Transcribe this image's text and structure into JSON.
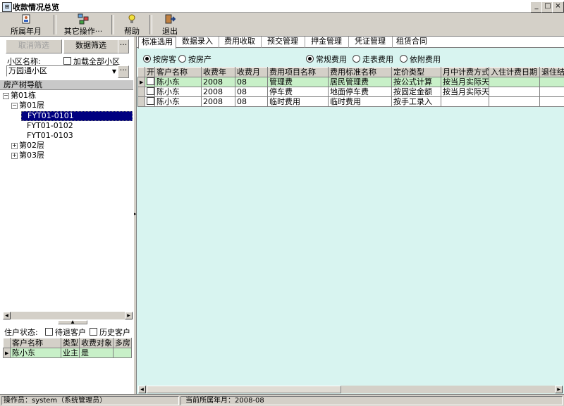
{
  "window": {
    "title": "收款情况总览",
    "controls": [
      "_",
      "□",
      "×"
    ]
  },
  "toolbar": {
    "buttons": [
      {
        "label": "所属年月",
        "icon": "calendar-person-icon"
      },
      {
        "label": "其它操作···",
        "icon": "network-icon"
      },
      {
        "label": "帮助",
        "icon": "help-bulb-icon"
      },
      {
        "label": "退出",
        "icon": "exit-door-icon"
      }
    ]
  },
  "left_panel": {
    "cancel_filter_label": "取消筛选",
    "data_filter_label": "数据筛选",
    "more_label": "···",
    "community_label": "小区名称:",
    "load_all_label": "加载全部小区",
    "community_value": "万园通小区",
    "tree_title": "房产树导航",
    "tree": [
      {
        "label": "第01栋",
        "toggle": "⊟"
      },
      {
        "label": "第01层",
        "toggle": "⊟"
      },
      {
        "label": "FYT01-0101",
        "selected": true
      },
      {
        "label": "FYT01-0102"
      },
      {
        "label": "FYT01-0103"
      },
      {
        "label": "第02层",
        "toggle": "⊞"
      },
      {
        "label": "第03层",
        "toggle": "⊞"
      }
    ],
    "resident_status_label": "住户状态:",
    "pending_label": "待退客户",
    "history_label": "历史客户",
    "customer_grid": {
      "columns": [
        "客户名称",
        "类型",
        "收费对象",
        "多房"
      ],
      "rows": [
        [
          "陈小东",
          "业主",
          "是",
          ""
        ]
      ]
    }
  },
  "right_panel": {
    "tabs": [
      "标准选用",
      "数据录入",
      "费用收取",
      "预交管理",
      "押金管理",
      "凭证管理",
      "租赁合同"
    ],
    "active_tab": 0,
    "by_room_label": "按房客",
    "by_property_label": "按房产",
    "regular_fee_label": "常规费用",
    "meter_fee_label": "走表费用",
    "attached_fee_label": "依附费用",
    "fee_grid": {
      "columns": [
        "开",
        "客户名称",
        "收费年",
        "收费月",
        "费用项目名称",
        "费用标准名称",
        "定价类型",
        "月中计费方式",
        "入住计费日期",
        "退住结"
      ],
      "rows": [
        [
          "",
          "陈小东",
          "2008",
          "08",
          "管理费",
          "居民管理费",
          "按公式计算",
          "按当月实际天",
          "",
          ""
        ],
        [
          "",
          "陈小东",
          "2008",
          "08",
          "停车费",
          "地面停车费",
          "按固定金额",
          "按当月实际天",
          "",
          ""
        ],
        [
          "",
          "陈小东",
          "2008",
          "08",
          "临时费用",
          "临时费用",
          "按手工录入",
          "",
          "",
          ""
        ]
      ]
    }
  },
  "statusbar": {
    "operator": "操作员：system（系统管理员）",
    "current_period": "当前所属年月：2008-08"
  },
  "colors": {
    "right_bg": "#d8f4f0",
    "selected_row": "#c8f0c8",
    "tree_selected": "#000080"
  }
}
